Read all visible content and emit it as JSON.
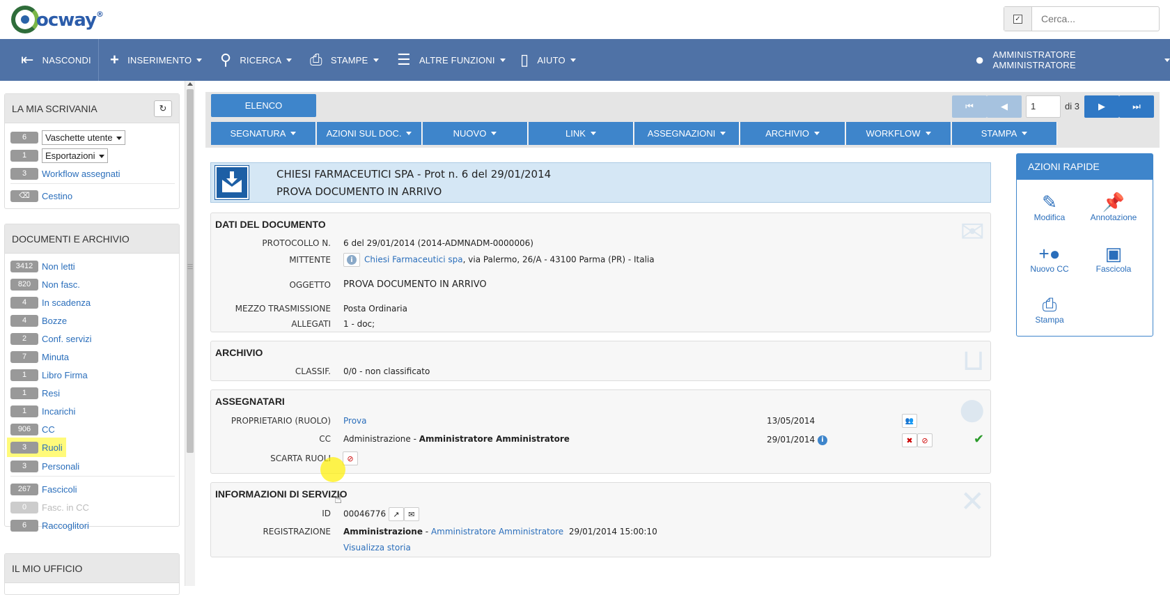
{
  "brand": {
    "name": "ocway",
    "reg": "®"
  },
  "search": {
    "placeholder": "Cerca..."
  },
  "nav": {
    "hide": "NASCONDI",
    "insert": "INSERIMENTO",
    "search": "RICERCA",
    "print": "STAMPE",
    "other": "ALTRE FUNZIONI",
    "help": "AIUTO",
    "user": "AMMINISTRATORE AMMINISTRATORE"
  },
  "desk": {
    "title": "LA MIA SCRIVANIA",
    "rows": [
      {
        "count": "6",
        "label": "Vaschette utente"
      },
      {
        "count": "1",
        "label": "Esportazioni"
      },
      {
        "count": "3",
        "label": "Workflow assegnati"
      }
    ],
    "trash": "Cestino"
  },
  "docs": {
    "title": "DOCUMENTI E ARCHIVIO",
    "items": [
      {
        "count": "3412",
        "label": "Non letti"
      },
      {
        "count": "820",
        "label": "Non fasc."
      },
      {
        "count": "4",
        "label": "In scadenza"
      },
      {
        "count": "4",
        "label": "Bozze"
      },
      {
        "count": "2",
        "label": "Conf. servizi"
      },
      {
        "count": "7",
        "label": "Minuta"
      },
      {
        "count": "1",
        "label": "Libro Firma"
      },
      {
        "count": "1",
        "label": "Resi"
      },
      {
        "count": "1",
        "label": "Incarichi"
      },
      {
        "count": "906",
        "label": "CC"
      },
      {
        "count": "3",
        "label": "Ruoli"
      },
      {
        "count": "3",
        "label": "Personali"
      }
    ],
    "items2": [
      {
        "count": "267",
        "label": "Fascicoli"
      },
      {
        "count": "0",
        "label": "Fasc. in CC"
      },
      {
        "count": "6",
        "label": "Raccoglitori"
      }
    ]
  },
  "office": {
    "title": "IL MIO UFFICIO"
  },
  "toolbar": {
    "list": "ELENCO",
    "page": "1",
    "of": "di 3",
    "actions": [
      "SEGNATURA",
      "AZIONI SUL DOC.",
      "NUOVO",
      "LINK",
      "ASSEGNAZIONI",
      "ARCHIVIO",
      "WORKFLOW",
      "STAMPA"
    ]
  },
  "doc": {
    "title": "CHIESI FARMACEUTICI SPA - Prot n. 6 del 29/01/2014",
    "subtitle": "PROVA DOCUMENTO IN ARRIVO"
  },
  "dati": {
    "title": "DATI DEL DOCUMENTO",
    "protocollo_label": "PROTOCOLLO N.",
    "protocollo": "6 del 29/01/2014 (2014-ADMNADM-0000006)",
    "mittente_label": "MITTENTE",
    "mittente_link": "Chiesi Farmaceutici spa",
    "mittente_addr": ", via Palermo, 26/A - 43100 Parma (PR) - Italia",
    "oggetto_label": "OGGETTO",
    "oggetto": "PROVA DOCUMENTO IN ARRIVO",
    "mezzo_label": "MEZZO TRASMISSIONE",
    "mezzo": "Posta Ordinaria",
    "allegati_label": "ALLEGATI",
    "allegati": "1 - doc;"
  },
  "archivio": {
    "title": "ARCHIVIO",
    "classif_label": "CLASSIF.",
    "classif": "0/0 - non classificato"
  },
  "assegnatari": {
    "title": "ASSEGNATARI",
    "owner_label": "PROPRIETARIO (RUOLO)",
    "owner": "Prova",
    "owner_date": "13/05/2014",
    "cc_label": "CC",
    "cc_office": "Administrazione",
    "cc_sep": " - ",
    "cc_person": "Amministratore Amministratore",
    "cc_date": "29/01/2014",
    "scarta_label": "SCARTA RUOLI"
  },
  "servizio": {
    "title": "INFORMAZIONI DI SERVIZIO",
    "id_label": "ID",
    "id": "00046776",
    "reg_label": "REGISTRAZIONE",
    "reg_office": "Amministrazione",
    "reg_sep": " - ",
    "reg_person": "Amministratore Amministratore",
    "reg_date": "29/01/2014 15:00:10",
    "history": "Visualizza storia"
  },
  "quick": {
    "title": "AZIONI RAPIDE",
    "edit": "Modifica",
    "note": "Annotazione",
    "cc": "Nuovo CC",
    "file": "Fascicola",
    "print": "Stampa"
  },
  "colors": {
    "nav": "#4f72a6",
    "accent": "#3e85cb",
    "highlight": "#fffa7a"
  }
}
